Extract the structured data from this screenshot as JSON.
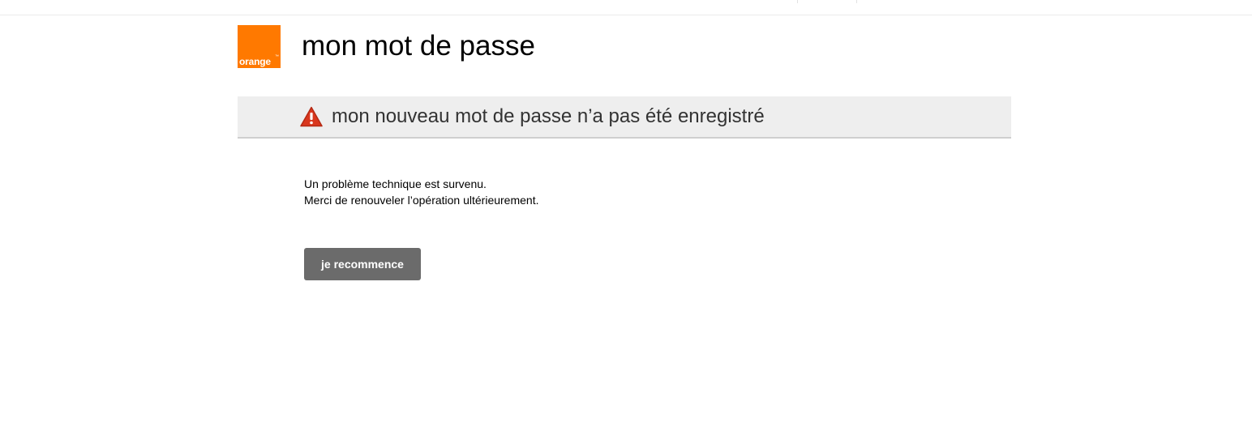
{
  "header": {
    "logo_text": "orange",
    "logo_tm": "™",
    "logo_color": "#ff7900",
    "page_title": "mon mot de passe"
  },
  "alert": {
    "icon": "warning-icon",
    "icon_color": "#d9371e",
    "text": "mon nouveau mot de passe n’a pas été enregistré"
  },
  "message": {
    "line1": "Un problème technique est survenu.",
    "line2": "Merci de renouveler l’opération ultérieurement."
  },
  "actions": {
    "restart_label": "je recommence"
  }
}
